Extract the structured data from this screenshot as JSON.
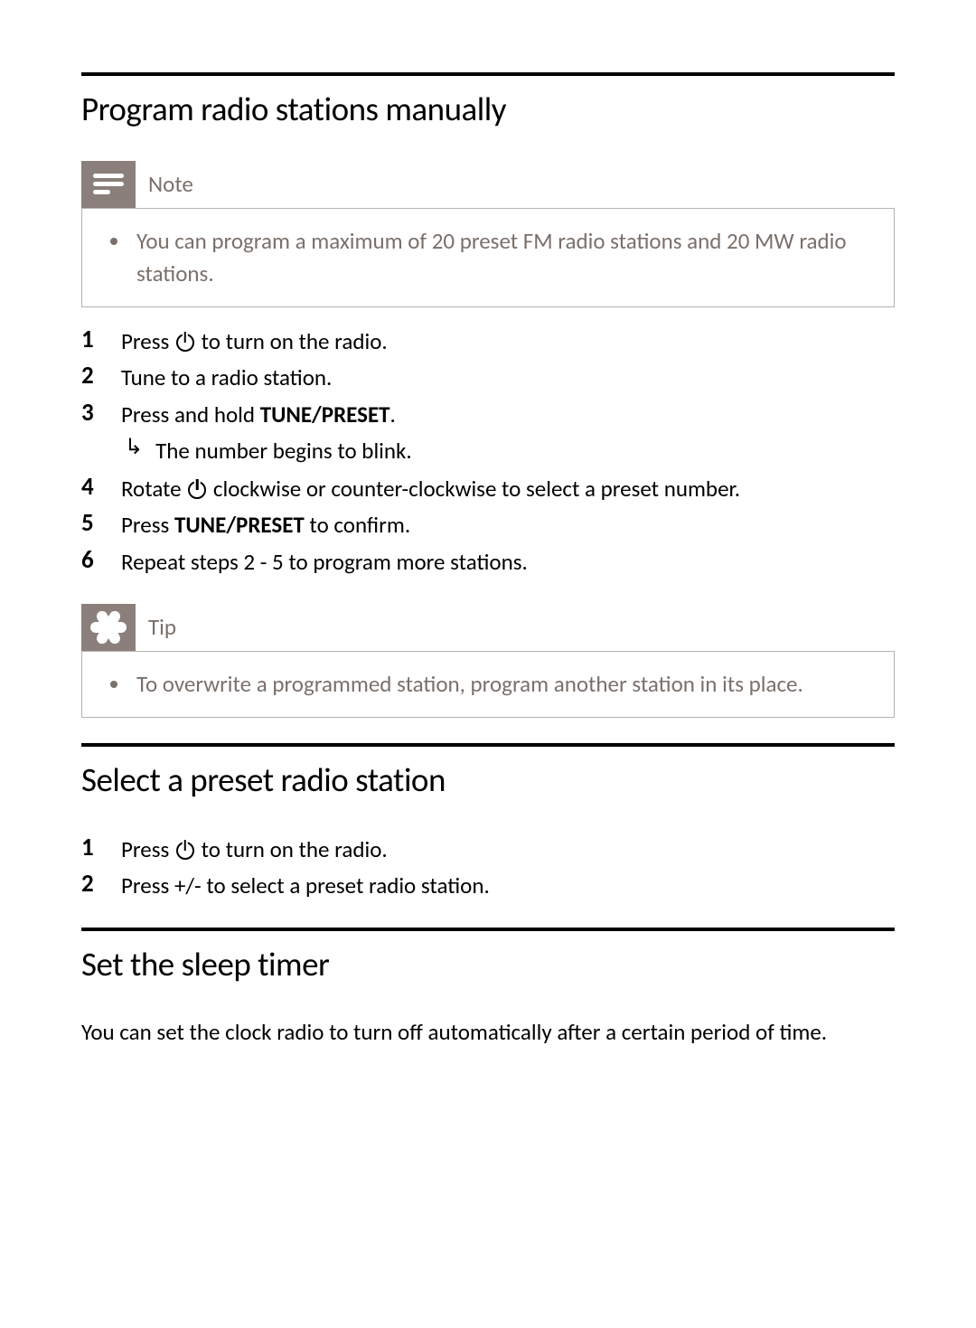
{
  "section1": {
    "title": "Program radio stations manually",
    "note_label": "Note",
    "note_text": "You can program a maximum of 20 preset FM radio stations and 20 MW radio stations.",
    "steps": {
      "s1a": "Press ",
      "s1b": " to turn on the radio.",
      "s2": "Tune to a radio station.",
      "s3a": "Press and hold ",
      "s3b": "TUNE/PRESET",
      "s3c": ".",
      "s3_sub": "The number begins to blink.",
      "s4a": "Rotate ",
      "s4b": " clockwise or counter-clockwise to select a preset number.",
      "s5a": "Press ",
      "s5b": "TUNE/PRESET",
      "s5c": " to confirm.",
      "s6": "Repeat steps 2 - 5 to program more stations."
    },
    "tip_label": "Tip",
    "tip_text": "To overwrite a programmed station, program another station in its place."
  },
  "section2": {
    "title": "Select a preset radio station",
    "steps": {
      "s1a": "Press ",
      "s1b": " to turn on the radio.",
      "s2": "Press +/- to select a preset radio station."
    }
  },
  "section3": {
    "title": "Set the sleep timer",
    "lead": "You can set the clock radio to turn off automatically after a certain period of time."
  }
}
